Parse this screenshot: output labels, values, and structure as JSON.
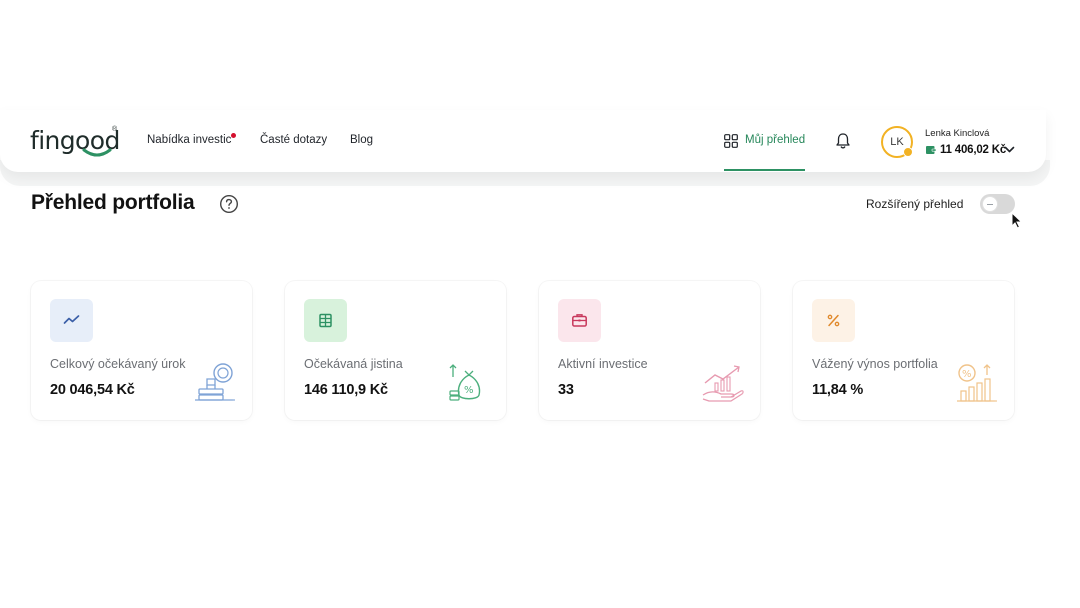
{
  "header": {
    "logo_text": "fingood",
    "logo_reg": "®",
    "nav": {
      "offer": "Nabídka investic",
      "faq": "Časté dotazy",
      "blog": "Blog"
    },
    "overview_link": "Můj přehled",
    "user": {
      "initials": "LK",
      "name": "Lenka Kinclová",
      "balance": "11 406,02 Kč"
    }
  },
  "page": {
    "title": "Přehled portfolia",
    "extended_view_label": "Rozšířený přehled",
    "extended_view_enabled": false
  },
  "cards": [
    {
      "label": "Celkový očekávaný úrok",
      "value": "20 046,54 Kč",
      "icon": "trend-line-icon",
      "color": "#3b5fa8",
      "bg": "#e7eef9"
    },
    {
      "label": "Očekávaná jistina",
      "value": "146 110,9 Kč",
      "icon": "banknotes-icon",
      "color": "#2d9163",
      "bg": "#d8f2dc"
    },
    {
      "label": "Aktivní investice",
      "value": "33",
      "icon": "briefcase-icon",
      "color": "#c8385c",
      "bg": "#fbe6ec"
    },
    {
      "label": "Vážený výnos portfolia",
      "value": "11,84 %",
      "icon": "percent-icon",
      "color": "#e0892b",
      "bg": "#fdf2e6"
    }
  ],
  "colors": {
    "accent_green": "#2d9163",
    "notification_red": "#d4102e",
    "avatar_ring": "#f2b224"
  }
}
